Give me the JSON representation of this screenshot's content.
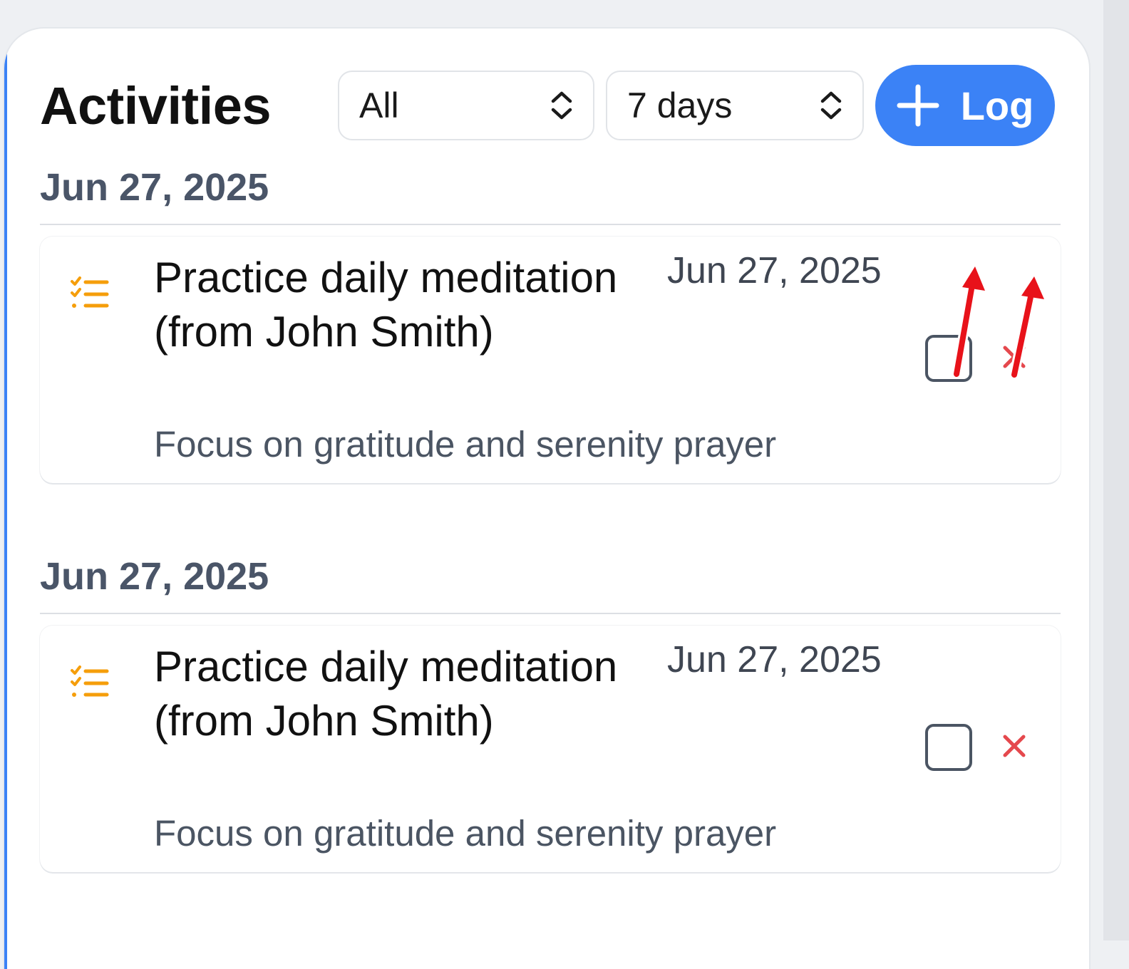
{
  "header": {
    "title": "Activities",
    "type_filter": {
      "selected": "All"
    },
    "range_filter": {
      "selected": "7 days"
    },
    "log_button": {
      "label": "Log",
      "icon": "plus-icon"
    }
  },
  "groups": [
    {
      "date": "Jun 27, 2025",
      "entries": [
        {
          "icon": "checklist-icon",
          "title": "Practice daily meditation (from John Smith)",
          "date": "Jun 27, 2025",
          "note": "Focus on gratitude and serenity prayer",
          "completed": false
        }
      ]
    },
    {
      "date": "Jun 27, 2025",
      "entries": [
        {
          "icon": "checklist-icon",
          "title": "Practice daily meditation (from John Smith)",
          "date": "Jun 27, 2025",
          "note": "Focus on gratitude and serenity prayer",
          "completed": false
        }
      ]
    }
  ],
  "colors": {
    "accent": "#3b82f6",
    "delete": "#e5484d",
    "task_icon": "#f59e0b",
    "annotation_arrow": "#e8121a"
  }
}
